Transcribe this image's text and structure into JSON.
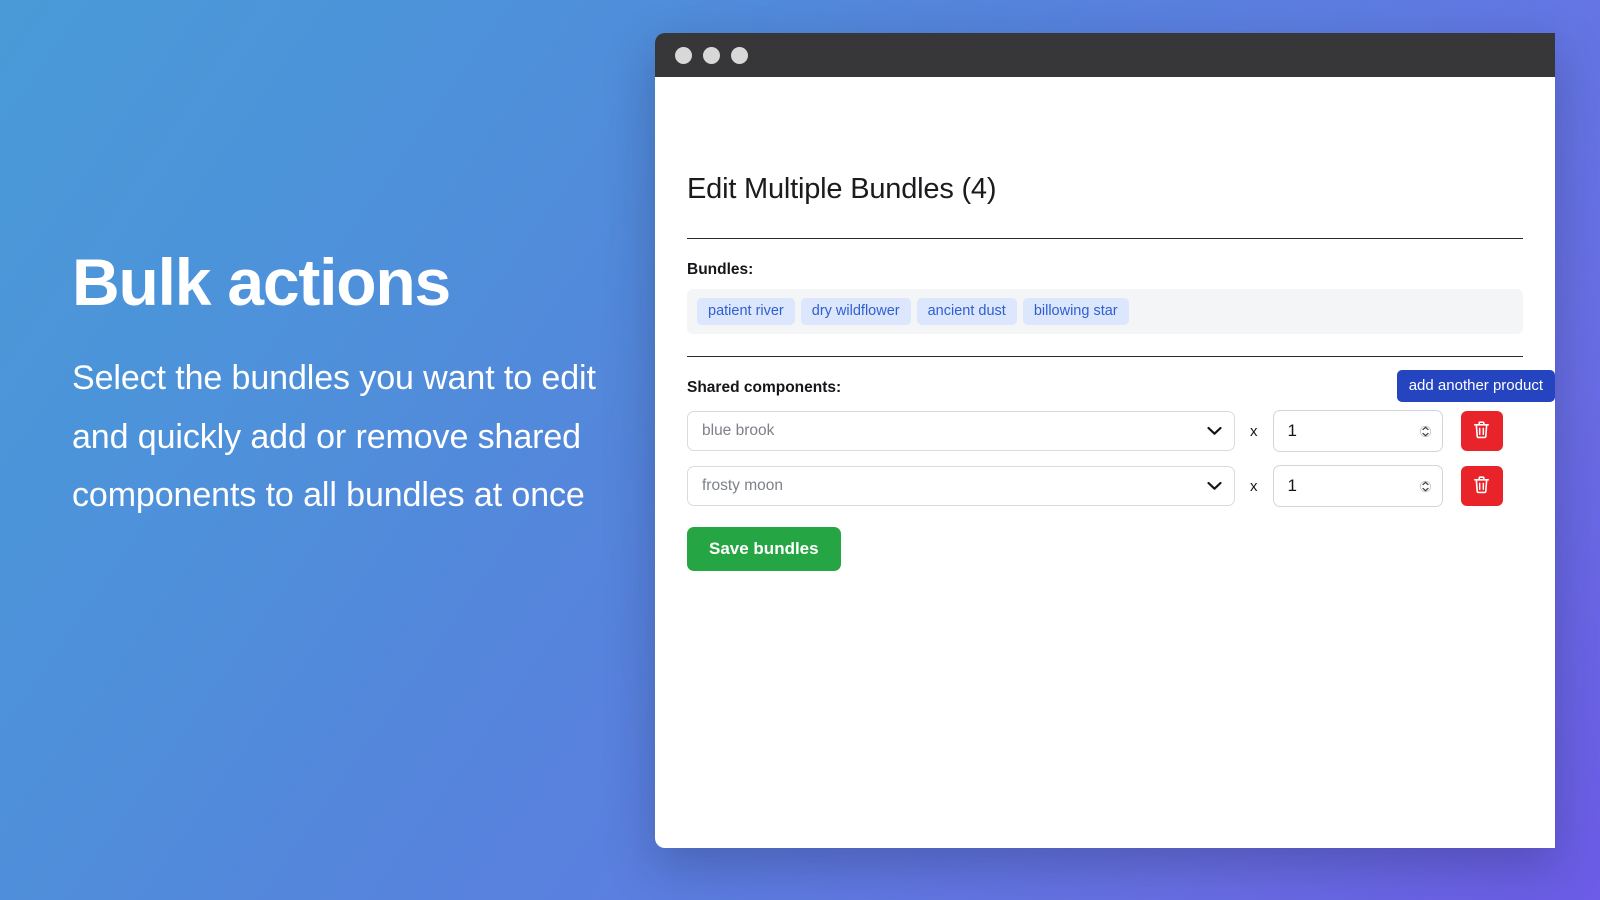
{
  "promo": {
    "title": "Bulk actions",
    "body": "Select the bundles you want to edit and quickly add or remove shared components to all bundles at once"
  },
  "window": {
    "traffic_lights": [
      "window-dot-1",
      "window-dot-2",
      "window-dot-3"
    ]
  },
  "card": {
    "title": "Edit Multiple Bundles (4)",
    "bundles_label": "Bundles:",
    "bundles": [
      {
        "label": "patient river"
      },
      {
        "label": "dry wildflower"
      },
      {
        "label": "ancient dust"
      },
      {
        "label": "billowing star"
      }
    ],
    "shared_components_label": "Shared components:",
    "add_product_label": "add another product",
    "multiply_symbol": "x",
    "rows": [
      {
        "product": "blue brook",
        "quantity": "1",
        "delete_icon": "trash-icon"
      },
      {
        "product": "frosty moon",
        "quantity": "1",
        "delete_icon": "trash-icon"
      }
    ],
    "save_label": "Save bundles"
  },
  "colors": {
    "accent_blue": "#2444c0",
    "tag_bg": "#dce7fd",
    "tag_text": "#2f5fd1",
    "danger_red": "#e8232a",
    "success_green": "#26a544",
    "gradient_start": "#4a9ad7",
    "gradient_end": "#6c5ce7"
  }
}
